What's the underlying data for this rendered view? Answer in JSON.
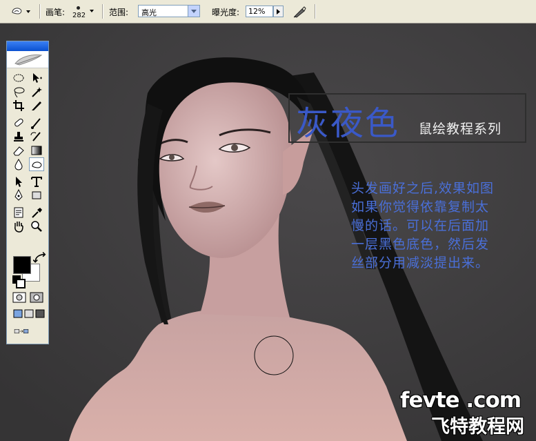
{
  "options_bar": {
    "brush_label": "画笔:",
    "brush_size": "282",
    "range_label": "范围:",
    "range_value": "高光",
    "exposure_label": "曝光度:",
    "exposure_value": "12%"
  },
  "canvas": {
    "title_main": "灰夜色",
    "title_sub": "鼠绘教程系列",
    "description_lines": [
      "头发画好之后,效果如图",
      "如果你觉得依靠复制太",
      "慢的话。可以在后面加",
      "一层黑色底色，然后发",
      "丝部分用减淡提出来。"
    ],
    "watermark_line1": "fevte .com",
    "watermark_line2": "飞特教程网"
  },
  "toolbox": {
    "foreground_color": "#000000",
    "background_color": "#ffffff"
  },
  "colors": {
    "canvas_bg": "#3b3a3b",
    "skin": "#d3a7a3",
    "text_blue": "#4a6fd8",
    "title_blue": "#3a59c8"
  }
}
